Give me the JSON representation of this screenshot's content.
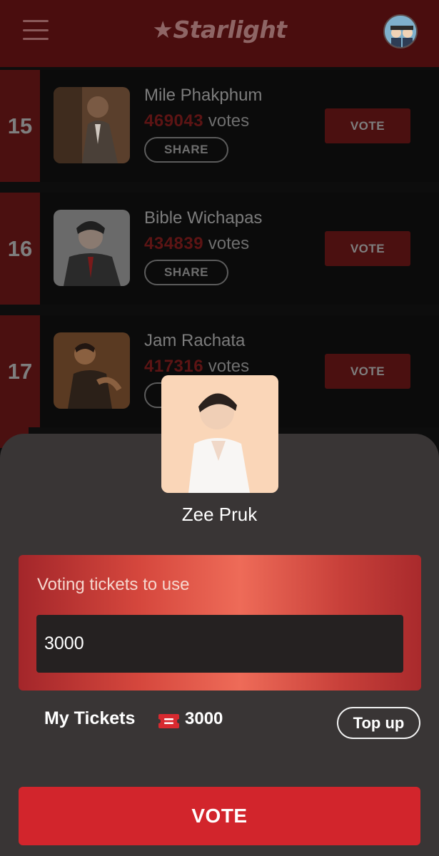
{
  "header": {
    "app_name": "Starlight",
    "menu_icon": "hamburger-menu-icon",
    "avatar_icon": "user-avatar-icon"
  },
  "rankings": [
    {
      "rank": "15",
      "name": "Mile Phakphum",
      "votes": "469043",
      "votes_suffix": "votes",
      "share_label": "SHARE",
      "vote_label": "VOTE"
    },
    {
      "rank": "16",
      "name": "Bible Wichapas",
      "votes": "434839",
      "votes_suffix": "votes",
      "share_label": "SHARE",
      "vote_label": "VOTE"
    },
    {
      "rank": "17",
      "name": "Jam Rachata",
      "votes": "417316",
      "votes_suffix": "votes",
      "share_label": "SHARE",
      "vote_label": "VOTE"
    }
  ],
  "vote_sheet": {
    "candidate_name": "Zee Pruk",
    "tickets_label": "Voting tickets to use",
    "tickets_value": "3000",
    "my_tickets_label": "My Tickets",
    "my_tickets_count": "3000",
    "ticket_icon": "ticket-icon",
    "top_up_label": "Top up",
    "vote_button_label": "VOTE"
  },
  "colors": {
    "header_bg": "#4a0d0e",
    "accent_red": "#d2252c",
    "sheet_bg": "#393535"
  }
}
